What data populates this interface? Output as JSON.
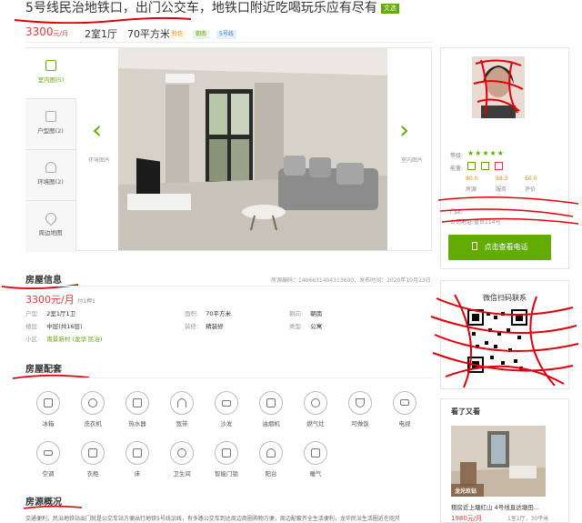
{
  "listing": {
    "title": "5号线民治地铁口，出门公交车，地铁口附近吃喝玩乐应有尽有",
    "title_badge": "文选",
    "price": "3300",
    "price_unit": "元/月",
    "rooms": "2室1厅",
    "area": "70平方米",
    "tags": [
      "拎包",
      "朝南",
      "5号线"
    ]
  },
  "gallery": {
    "tabs": [
      {
        "label": "室内图(5)"
      },
      {
        "label": "户型图(2)"
      },
      {
        "label": "环境图(2)"
      },
      {
        "label": "周边地图"
      }
    ],
    "prev_caption": "环境图片",
    "next_caption": "室内图片"
  },
  "agent": {
    "rating_label": "等级:",
    "ability_label": "能量:",
    "stats": [
      {
        "label": "房源",
        "value": "80.0"
      },
      {
        "label": "服务",
        "value": "98.3"
      },
      {
        "label": "评价",
        "value": "60.0"
      }
    ],
    "shop_text": "门店:",
    "company_text": "公司地址:盛世114号",
    "call_button": "点击查看电话"
  },
  "qr": {
    "title": "微信扫码联系"
  },
  "info": {
    "section_title": "房屋信息",
    "meta": "房源编码：1406631404313600，发布时间：2020年10月23日",
    "price": "3300元/月",
    "pay": "付1押1",
    "rows": [
      [
        {
          "k": "户型:",
          "v": "2室1厅1卫"
        },
        {
          "k": "面积:",
          "v": "70平方米"
        },
        {
          "k": "朝向:",
          "v": "朝南"
        }
      ],
      [
        {
          "k": "楼层:",
          "v": "中层(共16层)"
        },
        {
          "k": "装修:",
          "v": "精装修"
        },
        {
          "k": "类型:",
          "v": "公寓"
        }
      ]
    ],
    "community_label": "小区:",
    "community_value": "南景新村",
    "community_area": "(龙华 民治)"
  },
  "facilities": {
    "section_title": "房屋配套",
    "items": [
      "冰箱",
      "洗衣机",
      "热水器",
      "宽带",
      "沙发",
      "油烟机",
      "燃气灶",
      "可做饭",
      "电视",
      "空调",
      "衣柜",
      "床",
      "卫生间",
      "智能门锁",
      "阳台",
      "暖气"
    ]
  },
  "overview": {
    "section_title": "房源概况",
    "text": "交通便利，民治地铁站出门就是公交车站方便出行地铁5号线沿线，有多路公交车到达周边商圈购物方便，周边配套齐全生活便利，龙华民治生活圈近在咫尺"
  },
  "also_viewed": {
    "title": "看了又看",
    "items": [
      {
        "name": "租房近上塘红山 4号线直达塘田...",
        "price": "1980元/月",
        "meta": "1室1厅，30平米",
        "badge": "龙光玖钻"
      }
    ]
  },
  "colors": {
    "brand_green": "#62ab00",
    "price_red": "#e4393c",
    "scribble_red": "#e0000a"
  }
}
